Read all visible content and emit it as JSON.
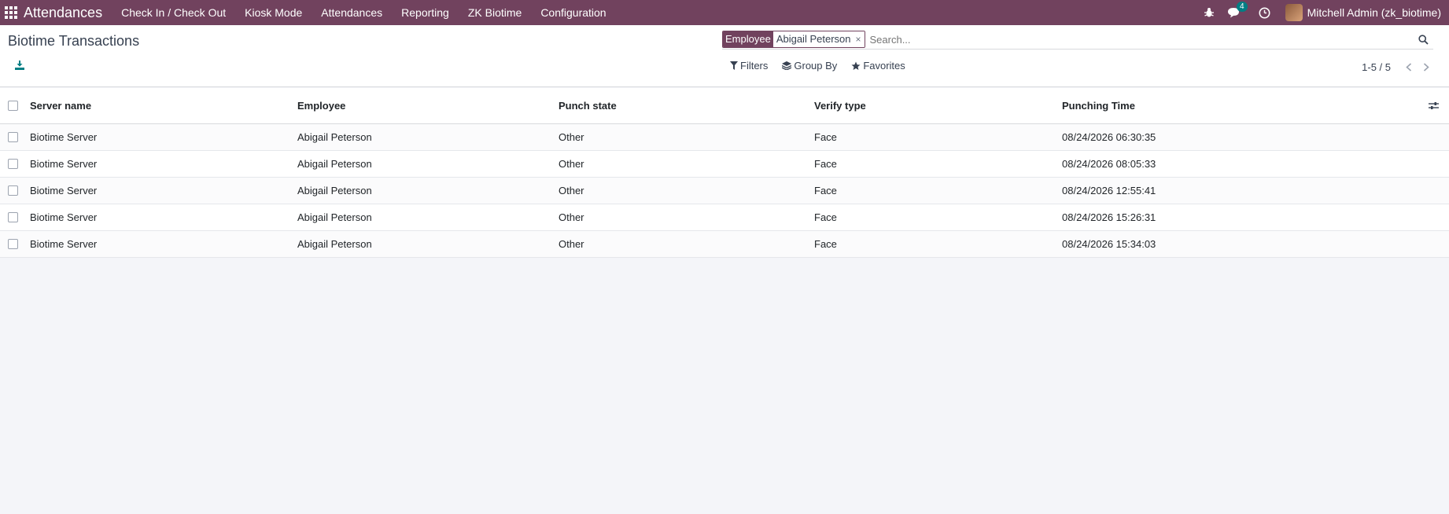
{
  "navbar": {
    "app_name": "Attendances",
    "menu": [
      "Check In / Check Out",
      "Kiosk Mode",
      "Attendances",
      "Reporting",
      "ZK Biotime",
      "Configuration"
    ],
    "messages_count": "4",
    "user": "Mitchell Admin (zk_biotime)"
  },
  "control_panel": {
    "title": "Biotime Transactions",
    "search": {
      "facet_label": "Employee",
      "facet_value": "Abigail Peterson",
      "facet_remove": "×",
      "placeholder": "Search..."
    },
    "filters_label": "Filters",
    "group_by_label": "Group By",
    "favorites_label": "Favorites",
    "pager": "1-5 / 5"
  },
  "table": {
    "columns": [
      "Server name",
      "Employee",
      "Punch state",
      "Verify type",
      "Punching Time"
    ],
    "rows": [
      [
        "Biotime Server",
        "Abigail Peterson",
        "Other",
        "Face",
        "08/24/2026 06:30:35"
      ],
      [
        "Biotime Server",
        "Abigail Peterson",
        "Other",
        "Face",
        "08/24/2026 08:05:33"
      ],
      [
        "Biotime Server",
        "Abigail Peterson",
        "Other",
        "Face",
        "08/24/2026 12:55:41"
      ],
      [
        "Biotime Server",
        "Abigail Peterson",
        "Other",
        "Face",
        "08/24/2026 15:26:31"
      ],
      [
        "Biotime Server",
        "Abigail Peterson",
        "Other",
        "Face",
        "08/24/2026 15:34:03"
      ]
    ]
  },
  "colors": {
    "brand": "#71425e",
    "accent": "#017e84"
  }
}
